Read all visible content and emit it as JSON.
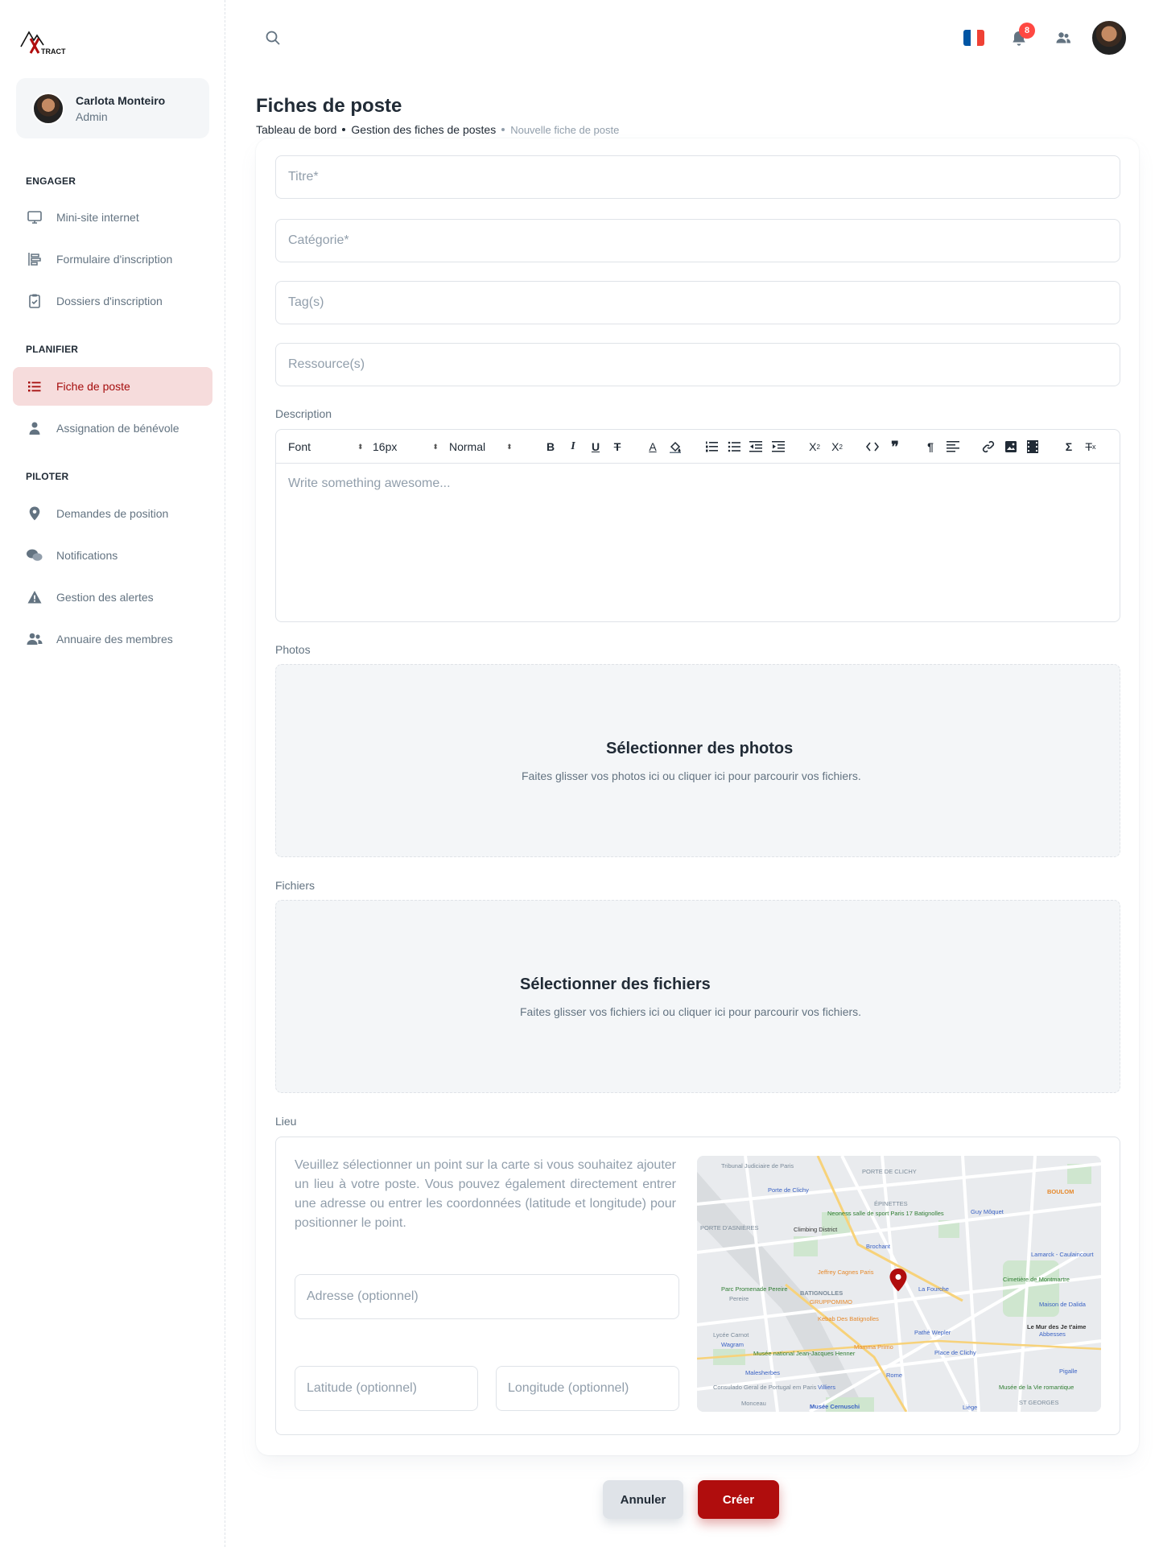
{
  "logo": {
    "text": "TRACT",
    "brand_color": "#b00d0d"
  },
  "account": {
    "name": "Carlota Monteiro",
    "role": "Admin"
  },
  "nav": {
    "sections": [
      {
        "title": "ENGAGER",
        "items": [
          {
            "label": "Mini-site internet",
            "icon": "monitor-icon"
          },
          {
            "label": "Formulaire d'inscription",
            "icon": "form-icon"
          },
          {
            "label": "Dossiers d'inscription",
            "icon": "clipboard-icon"
          }
        ]
      },
      {
        "title": "PLANIFIER",
        "items": [
          {
            "label": "Fiche de poste",
            "icon": "list-icon",
            "active": true
          },
          {
            "label": "Assignation de bénévole",
            "icon": "person-icon"
          }
        ]
      },
      {
        "title": "PILOTER",
        "items": [
          {
            "label": "Demandes de position",
            "icon": "pin-icon"
          },
          {
            "label": "Notifications",
            "icon": "chat-icon"
          },
          {
            "label": "Gestion des alertes",
            "icon": "warning-icon"
          },
          {
            "label": "Annuaire des membres",
            "icon": "people-icon"
          }
        ]
      }
    ]
  },
  "header": {
    "notification_count": "8",
    "language": "FR"
  },
  "page": {
    "title": "Fiches de poste",
    "breadcrumb": [
      "Tableau de bord",
      "Gestion des fiches de postes",
      "Nouvelle fiche de poste"
    ]
  },
  "form": {
    "title_placeholder": "Titre*",
    "category_placeholder": "Catégorie*",
    "tags_placeholder": "Tag(s)",
    "resources_placeholder": "Ressource(s)",
    "description_label": "Description",
    "editor": {
      "font": "Font",
      "size": "16px",
      "style": "Normal",
      "placeholder": "Write something awesome..."
    },
    "photos_label": "Photos",
    "photos_title": "Sélectionner des photos",
    "photos_sub": "Faites glisser vos photos ici ou cliquer ici pour parcourir vos fichiers.",
    "files_label": "Fichiers",
    "files_title": "Sélectionner des fichiers",
    "files_sub": "Faites glisser vos fichiers ici ou cliquer ici pour parcourir vos fichiers.",
    "lieu_label": "Lieu",
    "lieu_help": "Veuillez sélectionner un point sur la carte si vous souhaitez ajouter un lieu à votre poste. Vous pouvez également directement entrer une adresse ou entrer les coordonnées (latitude et longitude) pour positionner le point.",
    "address_placeholder": "Adresse (optionnel)",
    "latitude_placeholder": "Latitude  (optionnel)",
    "longitude_placeholder": "Longitude  (optionnel)"
  },
  "map": {
    "labels": [
      "PORTE DE CLICHY",
      "ÉPINETTES",
      "PORTE D'ASNIÈRES",
      "BATIGNOLLES",
      "ST GEORGES",
      "Climbing District",
      "Brochant",
      "La Fourche",
      "Place de Clichy",
      "Rome",
      "Villiers",
      "Malesherbes",
      "Wagram",
      "Pereire",
      "Monceau",
      "Musée Cernuschi",
      "Cimetière de Montmartre",
      "Abbesses",
      "Pigalle",
      "Lamarck - Caulaincourt",
      "Guy Môquet",
      "BOULOM",
      "Mamma Primo",
      "Kebab Des Batignolles",
      "GRUPPOMIMO",
      "Jeffrey Cagnes Paris",
      "Tribunal Judiciaire de Paris",
      "Neoness salle de sport Paris 17 Batignolles",
      "Lycée Carnot",
      "Musée national Jean-Jacques Henner",
      "Consulado Geral de Portugal em Paris",
      "Pathé Wepler",
      "Le Mur des Je t'aime",
      "Musée de la Vie romantique",
      "Maison de Dalida",
      "Liège",
      "Parc Promenade Pereire",
      "Porte de Clichy"
    ]
  },
  "actions": {
    "cancel": "Annuler",
    "create": "Créer"
  },
  "colors": {
    "accent": "#b00d0d",
    "active_bg": "#f6dcdc",
    "badge": "#ff4842"
  }
}
